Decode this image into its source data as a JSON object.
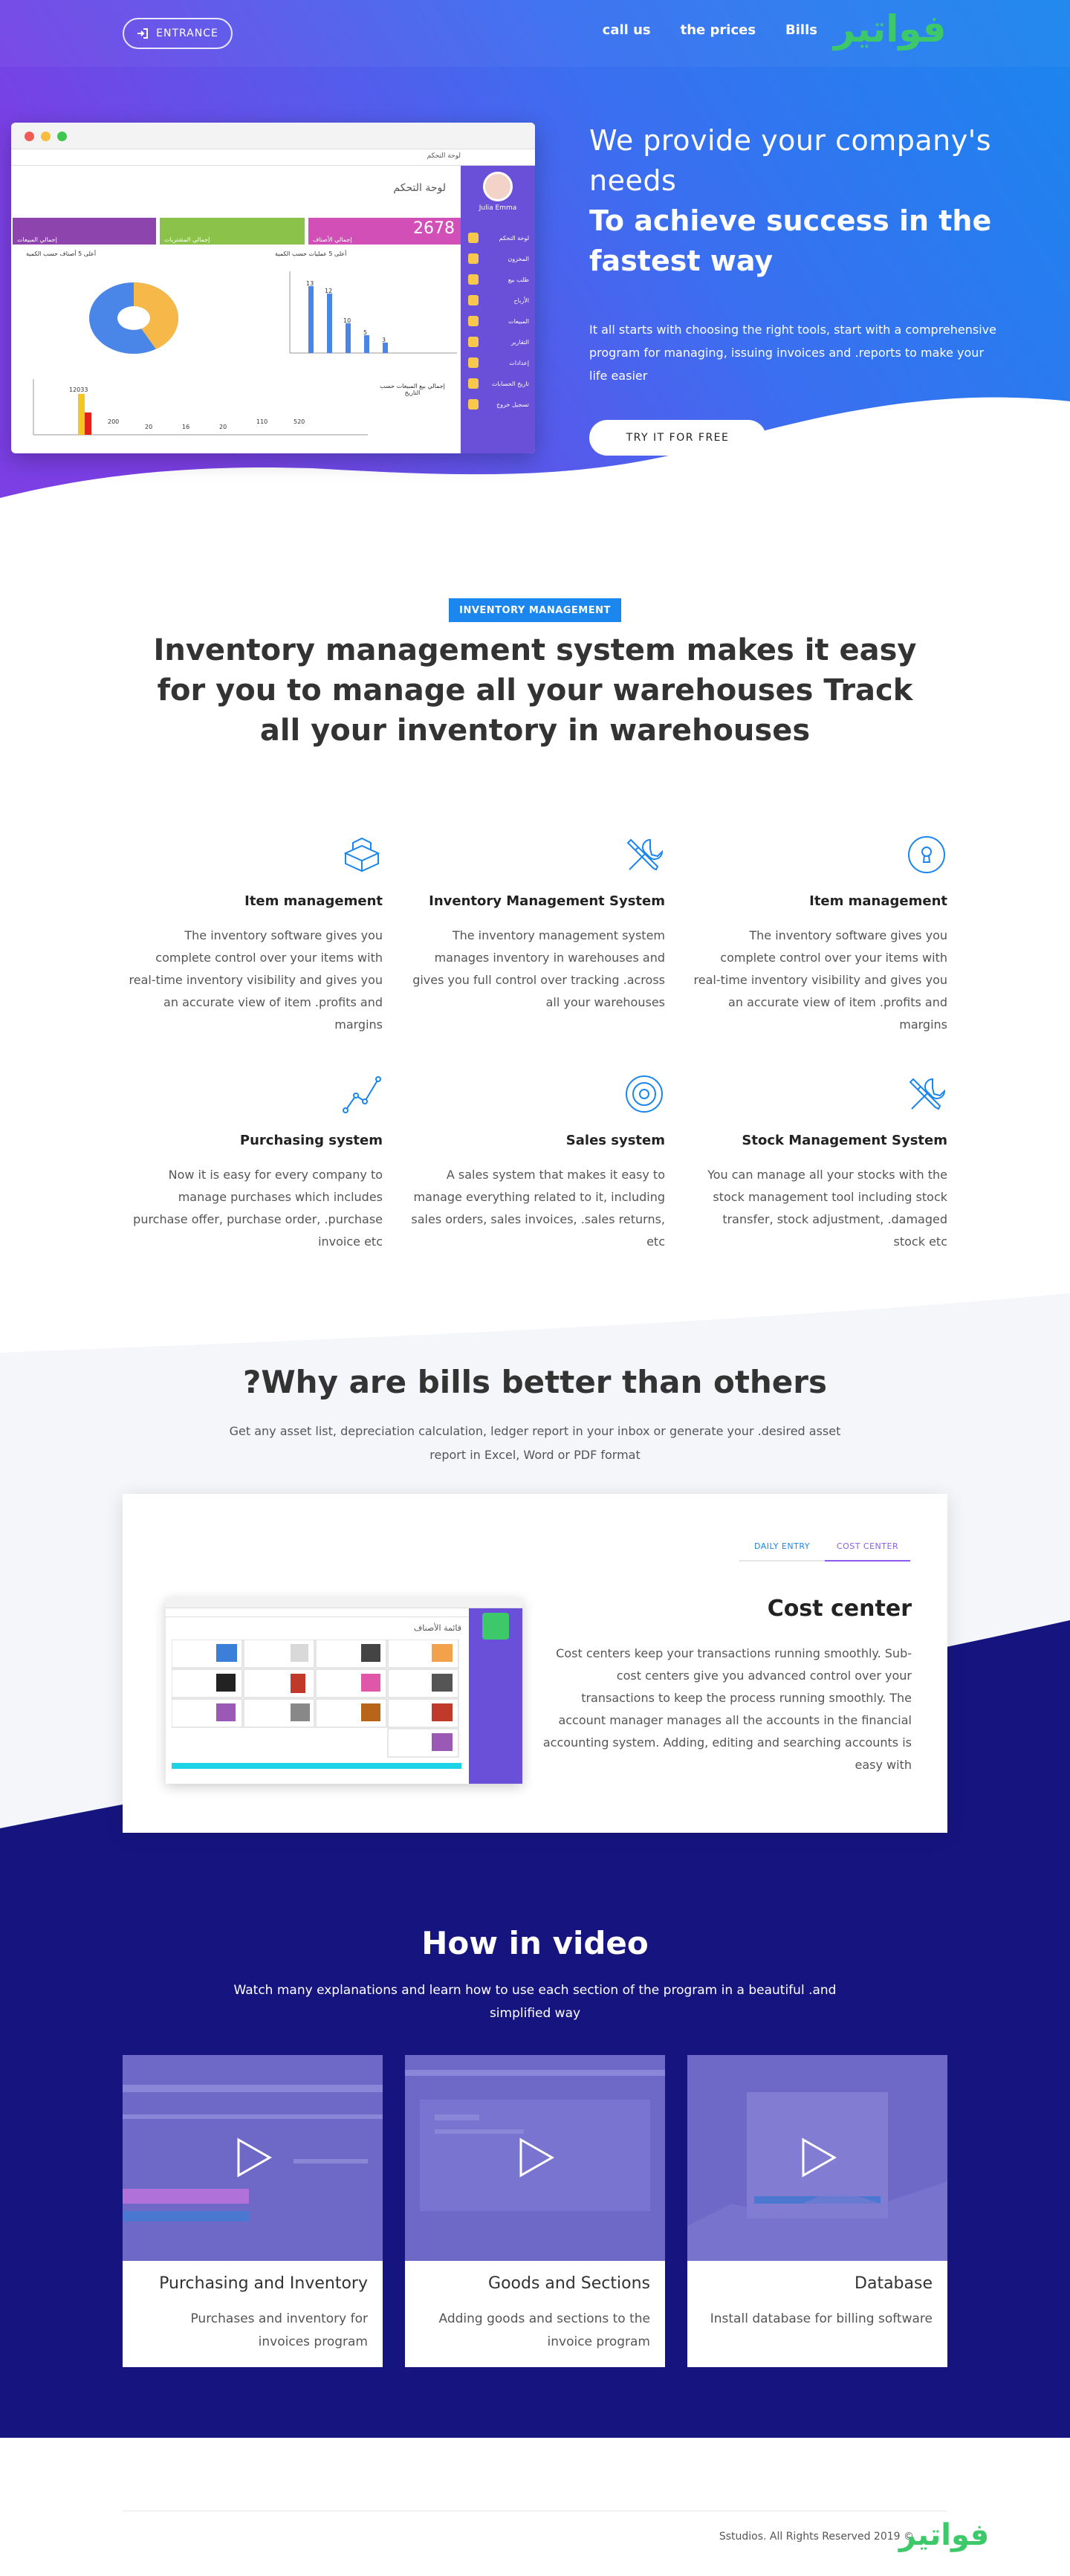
{
  "header": {
    "entrance_label": "ENTRANCE",
    "nav": [
      "call us",
      "the prices",
      "Bills"
    ],
    "logo_text": "فواتير"
  },
  "hero": {
    "title_line1": "We provide your company's needs",
    "title_line2": "To achieve success in the fastest way",
    "text": "It all starts with choosing the right tools, start with a comprehensive program for managing, issuing invoices and .reports to make your life easier",
    "cta": "TRY IT FOR FREE",
    "mock": {
      "window_title": "لوحة التحكم",
      "dashboard_title": "لوحة التحكم",
      "user_name": "Julia Emma",
      "tile_value": "2678",
      "tile_labels": [
        "إجمالي المبيعات",
        "إجمالي المشتريات",
        "إجمالي الأصناف"
      ],
      "sidebar_items": [
        "لوحة التحكم",
        "المخزون",
        "طلب بيع",
        "الأرباح",
        "المبيعات",
        "التقارير",
        "إعدادات",
        "تاريخ الحسابات",
        "تسجيل خروج"
      ],
      "chart1_title": "أعلى 5 أصناف حسب الكمية",
      "chart2_title": "أعلى 5 عمليات حسب الكمية",
      "chart3_title": "إجمالي بيع المبيعات حسب التاريخ",
      "bar_labels": [
        "13",
        "12",
        "10",
        "5",
        "3"
      ],
      "bar3_labels": [
        "12033",
        "200",
        "20",
        "16",
        "20",
        "110",
        "520"
      ]
    }
  },
  "inventory": {
    "badge": "INVENTORY MANAGEMENT",
    "title": "Inventory management system makes it easy for you to manage all your warehouses Track all your inventory in warehouses",
    "features": [
      {
        "icon": "lock-icon",
        "title": "Item management",
        "text": "The inventory software gives you complete control over your items with real-time inventory visibility and gives you an accurate view of item .profits and margins"
      },
      {
        "icon": "tools-icon",
        "title": "Inventory Management System",
        "text": "The inventory management system manages inventory in warehouses and gives you full control over tracking .across all your warehouses"
      },
      {
        "icon": "boxes-icon",
        "title": "Item management",
        "text": "The inventory software gives you complete control over your items with real-time inventory visibility and gives you an accurate view of item .profits and margins"
      },
      {
        "icon": "tools-icon",
        "title": "Stock Management System",
        "text": "You can manage all your stocks with the stock management tool including stock transfer, stock adjustment, .damaged stock etc"
      },
      {
        "icon": "target-icon",
        "title": "Sales system",
        "text": "A sales system that makes it easy to manage everything related to it, including sales orders, sales invoices, .sales returns, etc"
      },
      {
        "icon": "graph-icon",
        "title": "Purchasing system",
        "text": "Now it is easy for every company to manage purchases which includes purchase offer, purchase order, .purchase invoice etc"
      }
    ]
  },
  "why": {
    "title": "?Why are bills better than others",
    "subtitle": "Get any asset list, depreciation calculation, ledger report in your inbox or generate your .desired asset report in Excel, Word or PDF format",
    "tabs": [
      "DAILY ENTRY",
      "COST CENTER"
    ],
    "card_title": "Cost center",
    "card_text": "Cost centers keep your transactions running smoothly. Sub-cost centers give you advanced control over your transactions to keep the process running smoothly. The account manager manages all the accounts in the financial accounting system. Adding, editing and searching accounts is easy with",
    "shot_title": "قائمة الأصناف"
  },
  "video": {
    "title": "How in video",
    "subtitle": "Watch many explanations and learn how to use each section of the program in a beautiful .and simplified way",
    "cards": [
      {
        "title": "Purchasing and Inventory",
        "text": "Purchases and inventory for invoices program"
      },
      {
        "title": "Goods and Sections",
        "text": "Adding goods and sections to the invoice program"
      },
      {
        "title": "Database",
        "text": "Install database for billing software"
      }
    ]
  },
  "footer": {
    "copyright": "Sstudios. All Rights Reserved 2019 ©",
    "logo_text": "فواتير"
  },
  "colors": {
    "hero_gradient": [
      "#7b3fe4",
      "#1a86ee"
    ],
    "accent_blue": "#1a86ee",
    "navy": "#161580",
    "logo_green": "#3dc96a",
    "purple": "#8a5cf0"
  }
}
